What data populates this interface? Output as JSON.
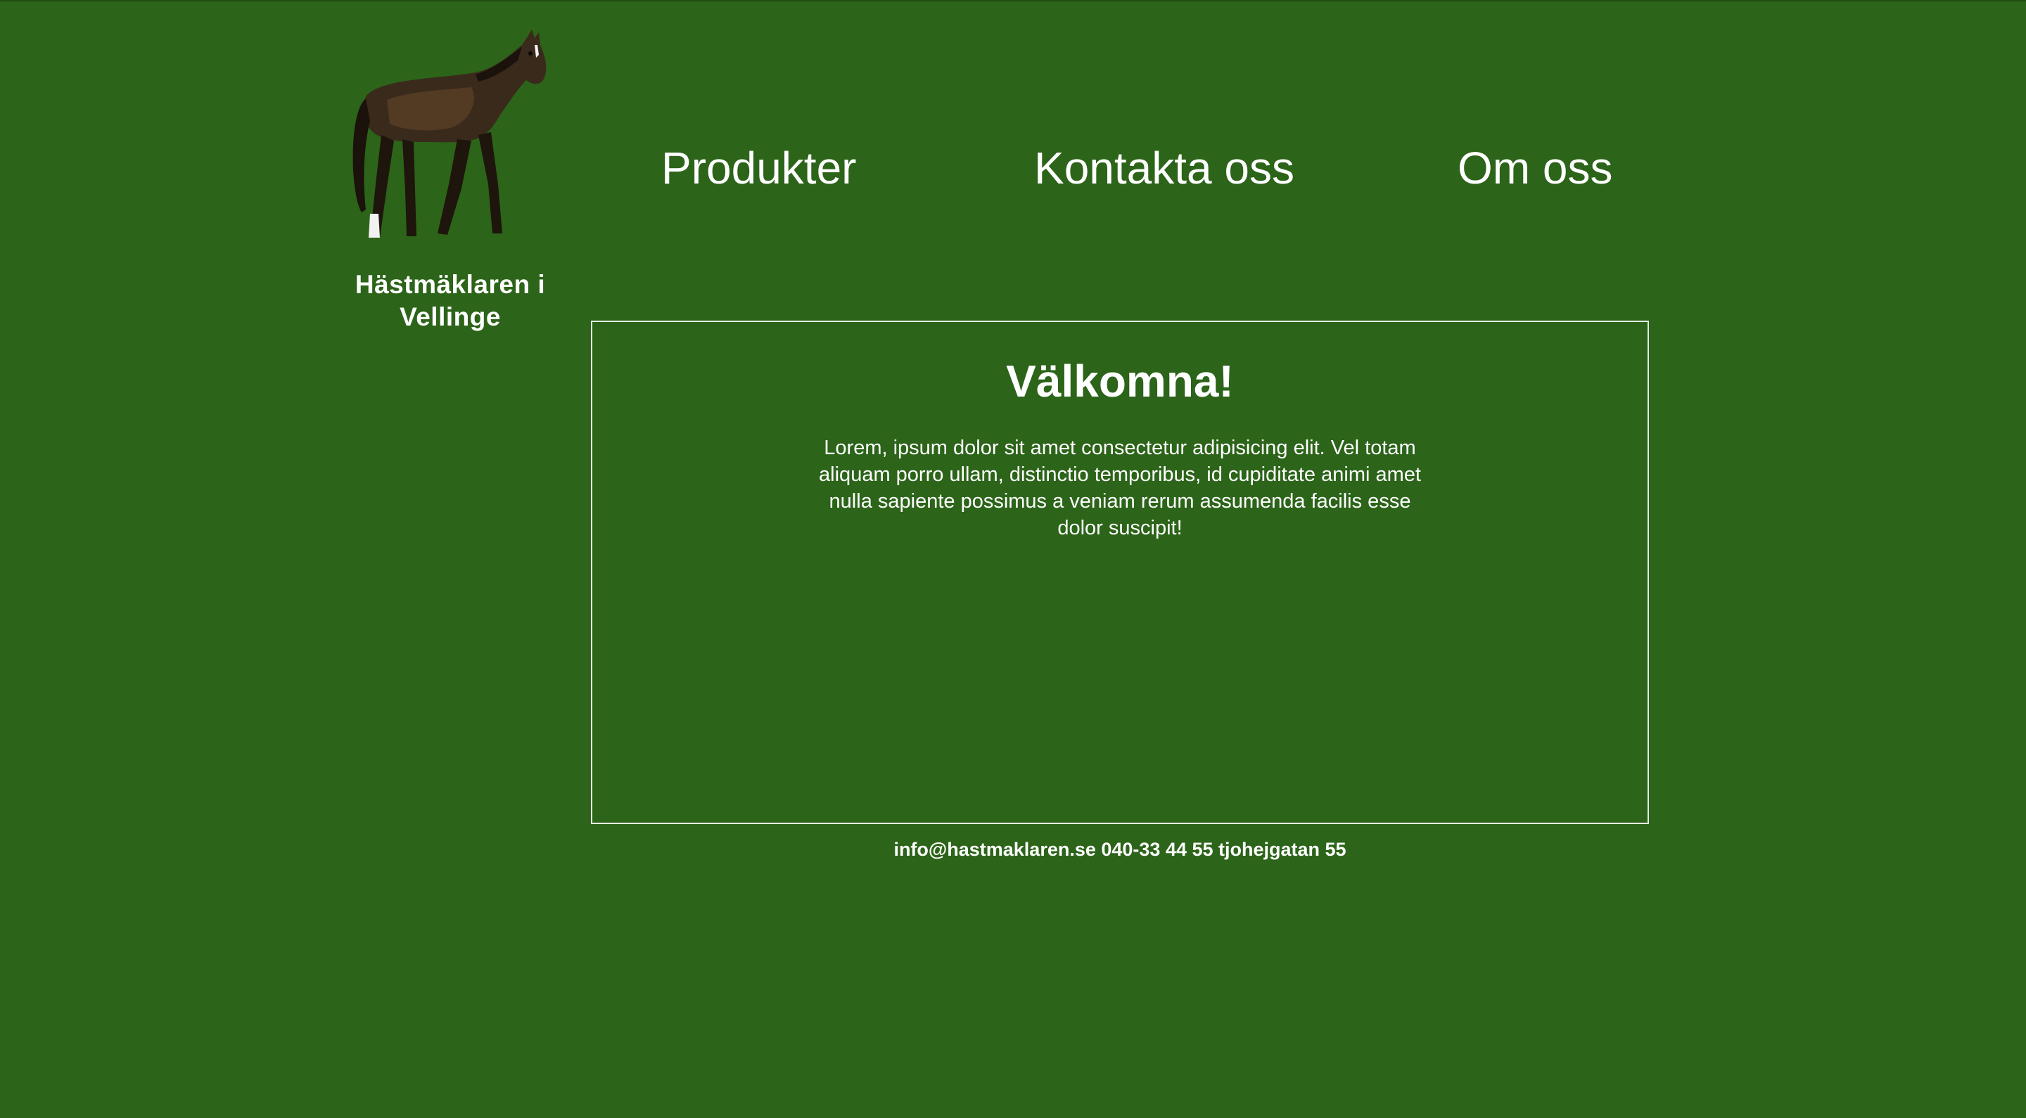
{
  "brand": {
    "name": "Hästmäklaren i Vellinge",
    "logo_icon": "horse-icon"
  },
  "nav": {
    "items": [
      {
        "label": "Produkter"
      },
      {
        "label": "Kontakta oss"
      },
      {
        "label": "Om oss"
      }
    ]
  },
  "main": {
    "title": "Välkomna!",
    "body": "Lorem, ipsum dolor sit amet consectetur adipisicing elit. Vel totam aliquam porro ullam, distinctio temporibus, id cupiditate animi amet nulla sapiente possimus a veniam rerum assumenda facilis esse dolor suscipit!"
  },
  "footer": {
    "text": "info@hastmaklaren.se 040-33 44 55 tjohejgatan 55"
  },
  "colors": {
    "background": "#2c6419",
    "text": "#ffffff",
    "border": "#e8f0e4"
  }
}
